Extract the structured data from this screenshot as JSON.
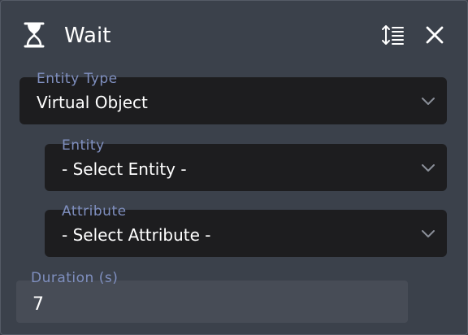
{
  "header": {
    "title": "Wait",
    "icons": [
      "hourglass-icon",
      "sort-lines-icon",
      "close-icon"
    ]
  },
  "fields": {
    "entity_type": {
      "label": "Entity Type",
      "value": "Virtual Object"
    },
    "entity": {
      "label": "Entity",
      "value": "- Select Entity -"
    },
    "attribute": {
      "label": "Attribute",
      "value": "- Select Attribute -"
    }
  },
  "duration": {
    "label": "Duration (s)",
    "value": "7"
  },
  "colors": {
    "panel_bg": "#3b414b",
    "field_bg": "#1d1d1f",
    "label": "#7f8fbf",
    "text": "#ffffff"
  }
}
